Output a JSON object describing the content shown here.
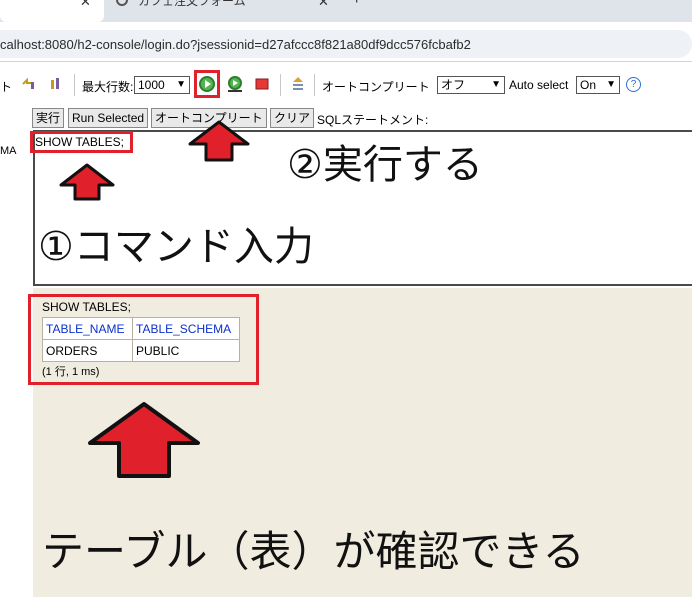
{
  "browser": {
    "tab_active_close": "✕",
    "tab2_title": "カフェ注文フォーム",
    "tab2_close": "✕",
    "new_tab": "+",
    "url": "calhost:8080/h2-console/login.do?jsessionid=d27afccc8f821a80df9dcc576fcbafb2"
  },
  "toolbar": {
    "frag_left": "ト",
    "max_rows_label": "最大行数:",
    "max_rows_value": "1000",
    "autocomplete_label": "オートコンプリート",
    "autocomplete_value": "オフ",
    "auto_select_label": "Auto select",
    "auto_select_value": "On",
    "help": "?"
  },
  "left_panel": {
    "fragment": "MA"
  },
  "command_bar": {
    "run_label": "実行",
    "run_selected_label": "Run Selected",
    "autocomplete_button_label": "オートコンプリート",
    "clear_label": "クリア",
    "sql_statement_label": "SQLステートメント:"
  },
  "editor": {
    "value": "SHOW TABLES;"
  },
  "result": {
    "sql": "SHOW TABLES;",
    "columns": [
      "TABLE_NAME",
      "TABLE_SCHEMA"
    ],
    "rows": [
      [
        "ORDERS",
        "PUBLIC"
      ]
    ],
    "footer": "(1 行, 1 ms)"
  },
  "annotations": {
    "step1": "①コマンド入力",
    "step2": "②実行する",
    "result_note": "テーブル（表）が確認できる"
  },
  "colors": {
    "highlight": "#e0202a",
    "header_text": "#0b2fd0",
    "result_background": "#f0ece0"
  }
}
